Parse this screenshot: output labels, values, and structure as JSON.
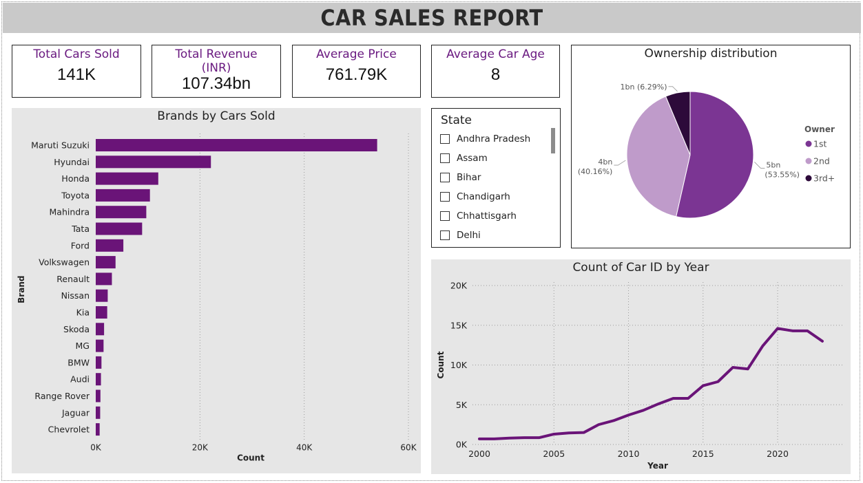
{
  "report": {
    "title": "CAR SALES REPORT"
  },
  "kpis": [
    {
      "label": "Total Cars Sold",
      "value": "141K"
    },
    {
      "label": "Total Revenue (INR)",
      "value": "107.34bn"
    },
    {
      "label": "Average Price",
      "value": "761.79K"
    },
    {
      "label": "Average Car Age",
      "value": "8"
    }
  ],
  "state_slicer": {
    "title": "State",
    "items": [
      "Andhra Pradesh",
      "Assam",
      "Bihar",
      "Chandigarh",
      "Chhattisgarh",
      "Delhi"
    ]
  },
  "colors": {
    "bar": "#6a1478",
    "line": "#6a1478",
    "pie_1st": "#7b3593",
    "pie_2nd": "#bf9bca",
    "pie_3rd": "#2d0a3a",
    "kpi_label": "#6a1a80"
  },
  "chart_data": [
    {
      "type": "bar",
      "orientation": "horizontal",
      "title": "Brands by Cars Sold",
      "xlabel": "Count",
      "ylabel": "Brand",
      "categories": [
        "Maruti Suzuki",
        "Hyundai",
        "Honda",
        "Toyota",
        "Mahindra",
        "Tata",
        "Ford",
        "Volkswagen",
        "Renault",
        "Nissan",
        "Kia",
        "Skoda",
        "MG",
        "BMW",
        "Audi",
        "Range Rover",
        "Jaguar",
        "Chevrolet"
      ],
      "values": [
        54000,
        22100,
        12000,
        10400,
        9700,
        8900,
        5300,
        3800,
        3100,
        2300,
        2200,
        1600,
        1500,
        1100,
        1000,
        900,
        850,
        750
      ],
      "xlim": [
        0,
        60000
      ],
      "xticks": [
        0,
        20000,
        40000,
        60000
      ],
      "xtick_labels": [
        "0K",
        "20K",
        "40K",
        "60K"
      ],
      "grid": true
    },
    {
      "type": "pie",
      "title": "Ownership distribution",
      "legend_title": "Owner",
      "legend_position": "right",
      "categories": [
        "1st",
        "2nd",
        "3rd+"
      ],
      "values": [
        53.55,
        40.16,
        6.29
      ],
      "data_labels": [
        {
          "main": "5bn",
          "pct": "(53.55%)"
        },
        {
          "main": "4bn",
          "pct": "(40.16%)"
        },
        {
          "main": "1bn (6.29%)",
          "pct": ""
        }
      ]
    },
    {
      "type": "line",
      "title": "Count of Car ID by Year",
      "xlabel": "Year",
      "ylabel": "Count",
      "x": [
        2000,
        2001,
        2002,
        2003,
        2004,
        2005,
        2006,
        2007,
        2008,
        2009,
        2010,
        2011,
        2012,
        2013,
        2014,
        2015,
        2016,
        2017,
        2018,
        2019,
        2020,
        2021,
        2022,
        2023
      ],
      "y": [
        700,
        700,
        800,
        850,
        850,
        1300,
        1450,
        1500,
        2500,
        3000,
        3700,
        4300,
        5100,
        5800,
        5800,
        7400,
        7900,
        9700,
        9500,
        12400,
        14600,
        14300,
        14300,
        13000
      ],
      "xlim": [
        2000,
        2023
      ],
      "ylim": [
        0,
        20000
      ],
      "xticks": [
        2000,
        2005,
        2010,
        2015,
        2020
      ],
      "yticks": [
        0,
        5000,
        10000,
        15000,
        20000
      ],
      "ytick_labels": [
        "0K",
        "5K",
        "10K",
        "15K",
        "20K"
      ],
      "grid": true
    }
  ]
}
